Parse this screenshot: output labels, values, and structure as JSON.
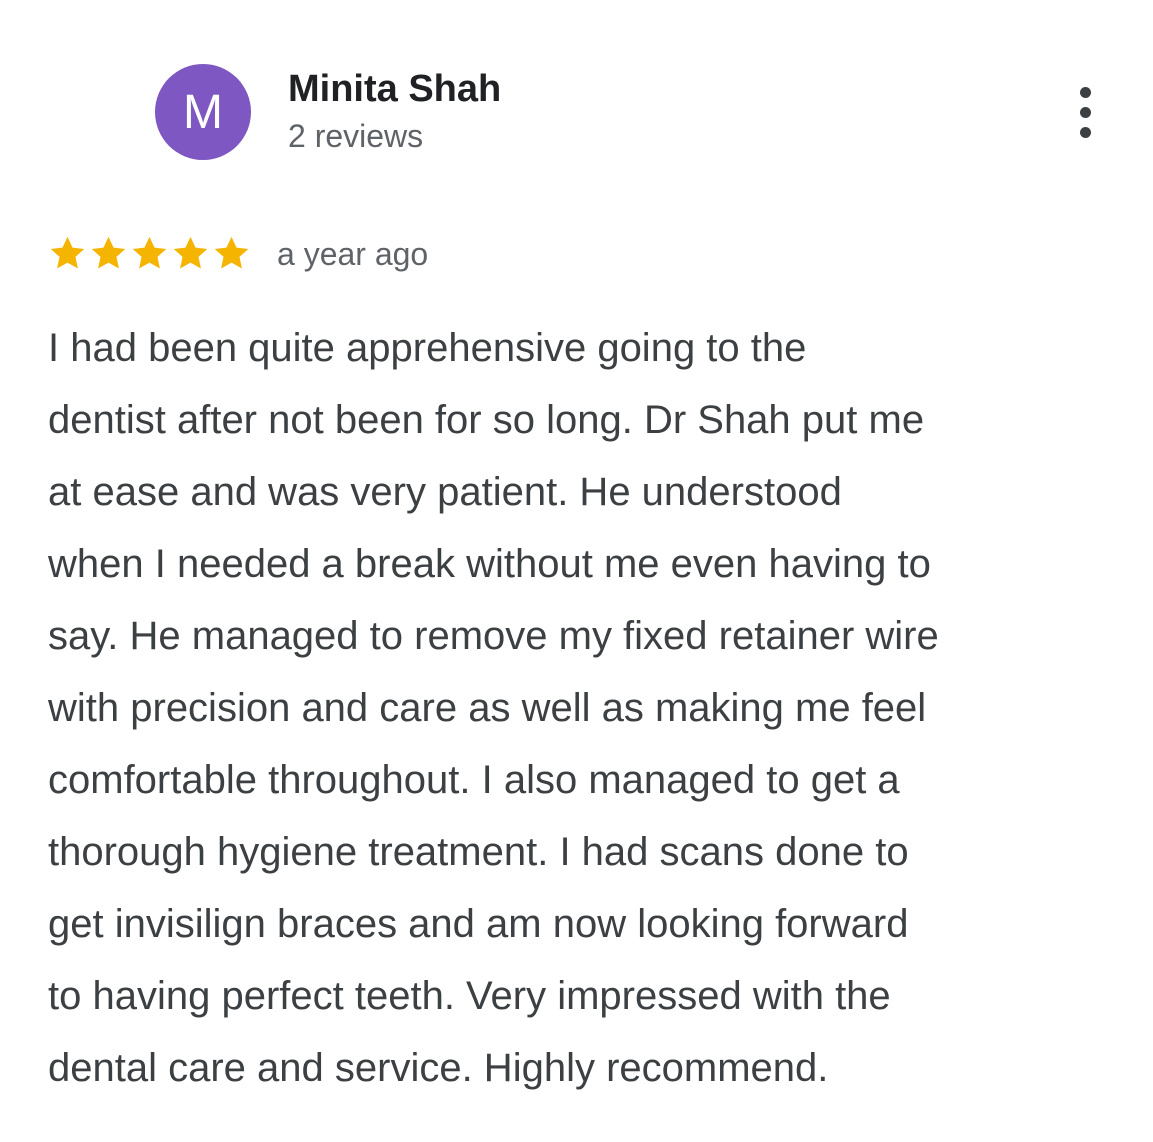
{
  "reviewer": {
    "initial": "M",
    "avatar_color": "#7e57c2",
    "name": "Minita Shah",
    "review_count": "2 reviews"
  },
  "menu": {
    "icon": "more-vert-icon"
  },
  "rating": {
    "stars": 5,
    "max_stars": 5,
    "star_color": "#f4b400",
    "icon": "star-icon"
  },
  "review": {
    "date": "a year ago",
    "lines": [
      "I had been quite apprehensive going to the",
      "dentist after not been for so long. Dr Shah put me",
      "at ease and was very patient. He understood",
      "when I needed a break without me even having to",
      "say. He managed to remove my fixed retainer wire",
      "with precision and care as well as making me feel",
      "comfortable throughout. I also managed to get a",
      "thorough hygiene treatment. I had scans done to",
      "get invisilign braces and am now looking forward",
      "to having perfect teeth. Very impressed with the",
      "dental care and service. Highly recommend."
    ]
  }
}
